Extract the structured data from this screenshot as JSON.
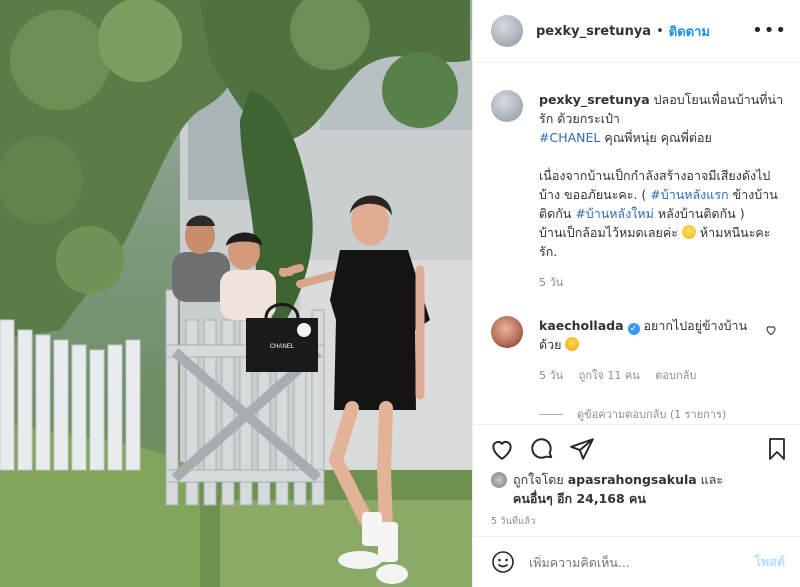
{
  "post": {
    "username": "pexky_sretunya",
    "dot": "•",
    "follow_label": "ติดตาม",
    "more_label": "•••"
  },
  "caption": {
    "username": "pexky_sretunya",
    "line1": "ปลอบโยนเพื่อนบ้านที่น่ารัก ด้วยกระเป๋า",
    "hashtag_chanel": "#CHANEL",
    "line1_tail": " คุณพี่หนุ่ย คุณพี่ต่อย",
    "para2_a": "เนื่องจากบ้านเป็กกำลังสร้างอาจมีเสียงดังไปบ้าง ขออภัยนะคะ. ( ",
    "hashtag_1": "#บ้านหลังแรก",
    "para2_b": " ข้างบ้านติดกัน ",
    "hashtag_2": "#บ้านหลังใหม่",
    "para2_c": " หลังบ้านติดกัน )",
    "para3_a": "บ้านเป็กล้อมไว้หมดเลยค่ะ ",
    "para3_b": " ห้ามหนีนะคะ รัก.",
    "age": "5 วัน"
  },
  "comment": {
    "username": "kaechollada",
    "text_a": "อยากไปอยู่ข้างบ้าน",
    "text_b": "ด้วย",
    "age": "5 วัน",
    "likes": "ถูกใจ 11 คน",
    "reply_label": "ตอบกลับ",
    "view_replies": "ดูข้อความตอบกลับ (1 รายการ)"
  },
  "likes": {
    "prefix": "ถูกใจโดย ",
    "user": "apasrahongsakula",
    "mid": " และ",
    "others": "คนอื่นๆ อีก 24,168 คน"
  },
  "timestamp": "5 วันที่แล้ว",
  "add_comment": {
    "placeholder": "เพิ่มความคิดเห็น...",
    "post_label": "โพสต์"
  },
  "photo": {
    "bag_label": "CHANEL"
  },
  "colors": {
    "link": "#1e8ef0",
    "hashtag": "#2b6db6",
    "muted": "#8e8e8e",
    "post_disabled": "#b2dffc"
  }
}
